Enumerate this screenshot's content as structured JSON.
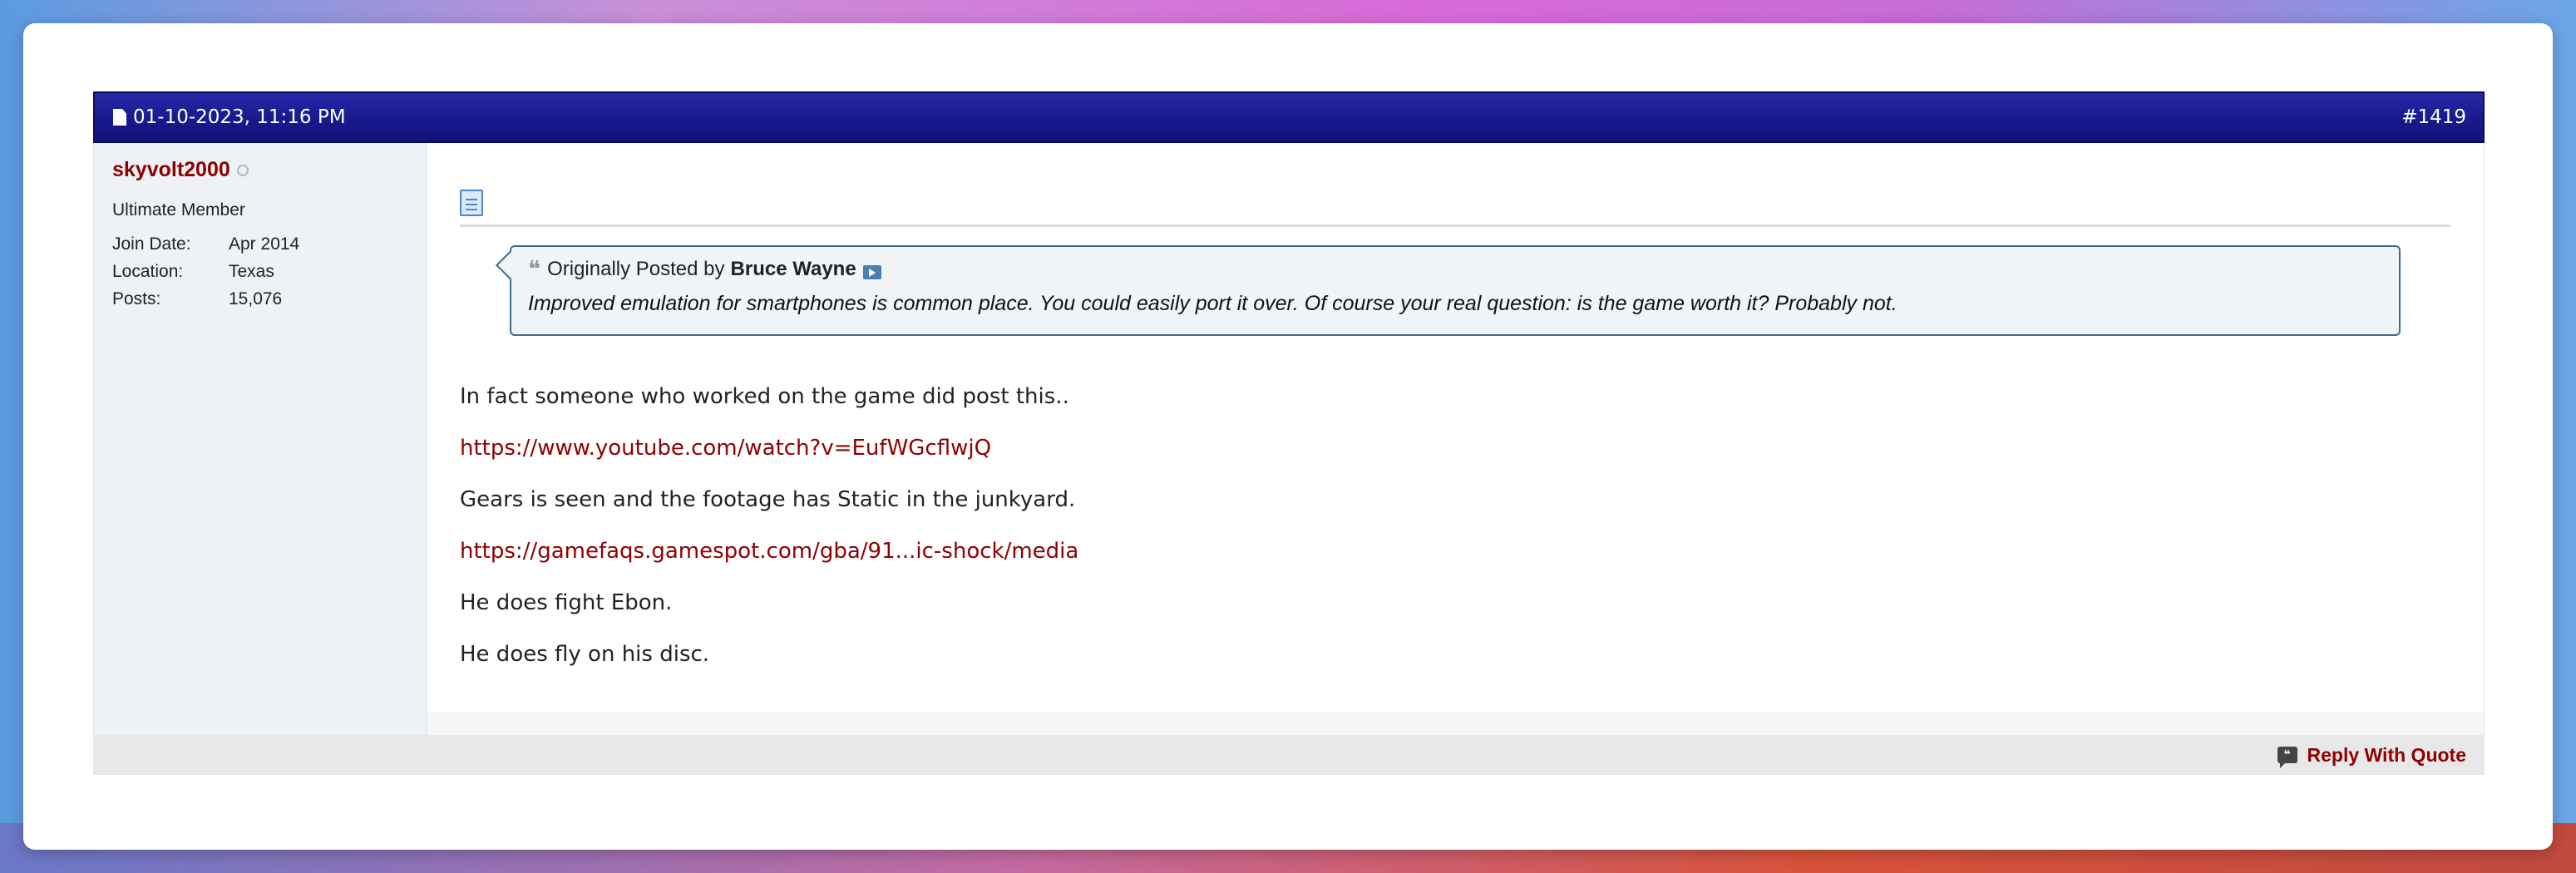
{
  "post": {
    "date": "01-10-2023, 11:16 PM",
    "number": "#1419",
    "user": {
      "name": "skyvolt2000",
      "title": "Ultimate Member",
      "stats": [
        {
          "label": "Join Date:",
          "value": "Apr 2014"
        },
        {
          "label": "Location:",
          "value": "Texas"
        },
        {
          "label": "Posts:",
          "value": "15,076"
        }
      ]
    },
    "quote": {
      "prefix": "Originally Posted by",
      "author": "Bruce Wayne",
      "text": "Improved emulation for smartphones is common place. You could easily port it over. Of course your real question: is the game worth it? Probably not."
    },
    "message": {
      "line1": "In fact someone who worked on the game did post this..",
      "link1": "https://www.youtube.com/watch?v=EufWGcflwjQ",
      "line2": "Gears is seen and the footage has Static in the junkyard.",
      "link2": "https://gamefaqs.gamespot.com/gba/91...ic-shock/media",
      "line3": "He does fight Ebon.",
      "line4": "He does fly on his disc."
    },
    "footer": {
      "reply_with_quote": "Reply With Quote"
    }
  },
  "colors": {
    "header": "#1a1a90",
    "username": "#8f0000",
    "link": "#8f0000",
    "quote_border": "#3c6e8c",
    "sidebar": "#eef2f6"
  },
  "icons": {
    "post_date": "document-icon",
    "post_type": "post-icon",
    "quote": "quote-icon",
    "view_post": "view-post-icon",
    "reply": "reply-quote-icon",
    "status": "offline-status-icon"
  }
}
